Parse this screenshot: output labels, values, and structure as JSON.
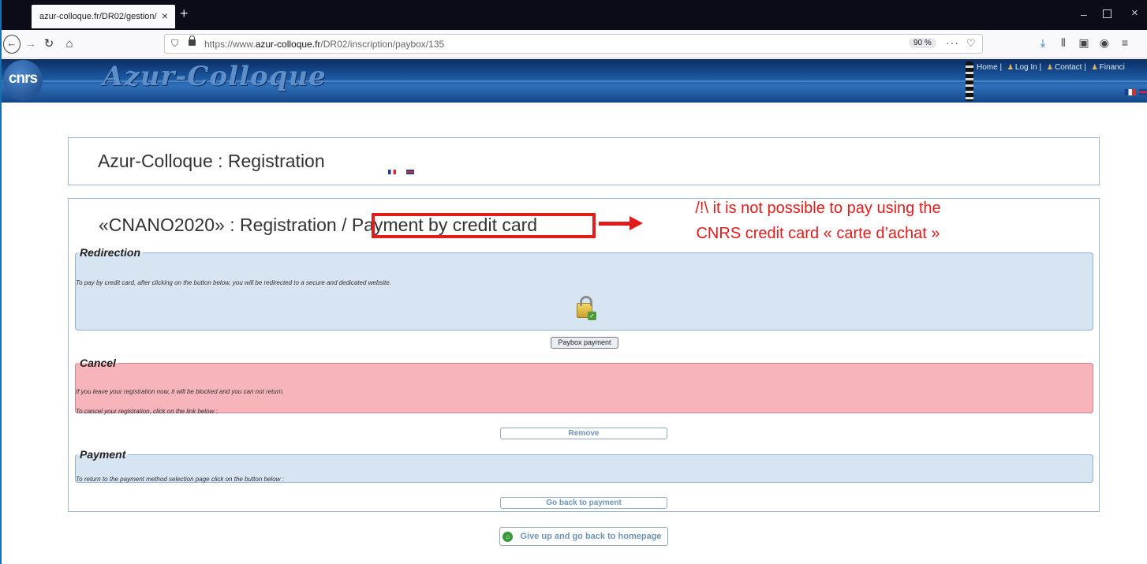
{
  "browser": {
    "tab_title": "azur-colloque.fr/DR02/gestion/",
    "url_prefix": "https://www.",
    "url_domain": "azur-colloque.fr",
    "url_path": "/DR02/inscription/paybox/135",
    "zoom": "90 %",
    "page_actions": "···"
  },
  "site": {
    "title": "Azur-Colloque",
    "logo_text": "cnrs",
    "top_links": [
      "Home",
      "Log In",
      "Contact",
      "Financi"
    ]
  },
  "registration_header": {
    "title": "Azur-Colloque : Registration"
  },
  "main": {
    "title": "«CNANO2020» : Registration / Payment by credit card",
    "annotation_line1": "/!\\ it is not possible to pay using the",
    "annotation_line2": "CNRS credit card « carte d’achat »",
    "redirection": {
      "legend": "Redirection",
      "text": "To pay by credit card, after clicking on the button below, you will be redirected to a secure and dedicated website."
    },
    "paybox_button": "Paybox payment",
    "cancel": {
      "legend": "Cancel",
      "text1": "If you leave your registration now, it will be blocked and you can not return.",
      "text2": "To cancel your registration, click on the link below :"
    },
    "remove_button": "Remove",
    "payment": {
      "legend": "Payment",
      "text": "To return to the payment method selection page click on the button below :"
    },
    "back_button": "Go back to payment"
  },
  "give_up_button": "Give up and go back to homepage",
  "colors": {
    "header_blue": "#1c5aa3",
    "annotation_red": "#e21b1b",
    "section_blue": "#d7e4f1",
    "section_pink": "#f8b4bb"
  },
  "icons": [
    "back-icon",
    "forward-icon",
    "reload-icon",
    "home-icon",
    "shield-icon",
    "lock-icon",
    "pocket-icon",
    "download-icon",
    "library-icon",
    "sidebar-icon",
    "account-icon",
    "menu-icon",
    "lighthouse-icon",
    "user-icon",
    "padlock-icon",
    "home-green-icon"
  ]
}
